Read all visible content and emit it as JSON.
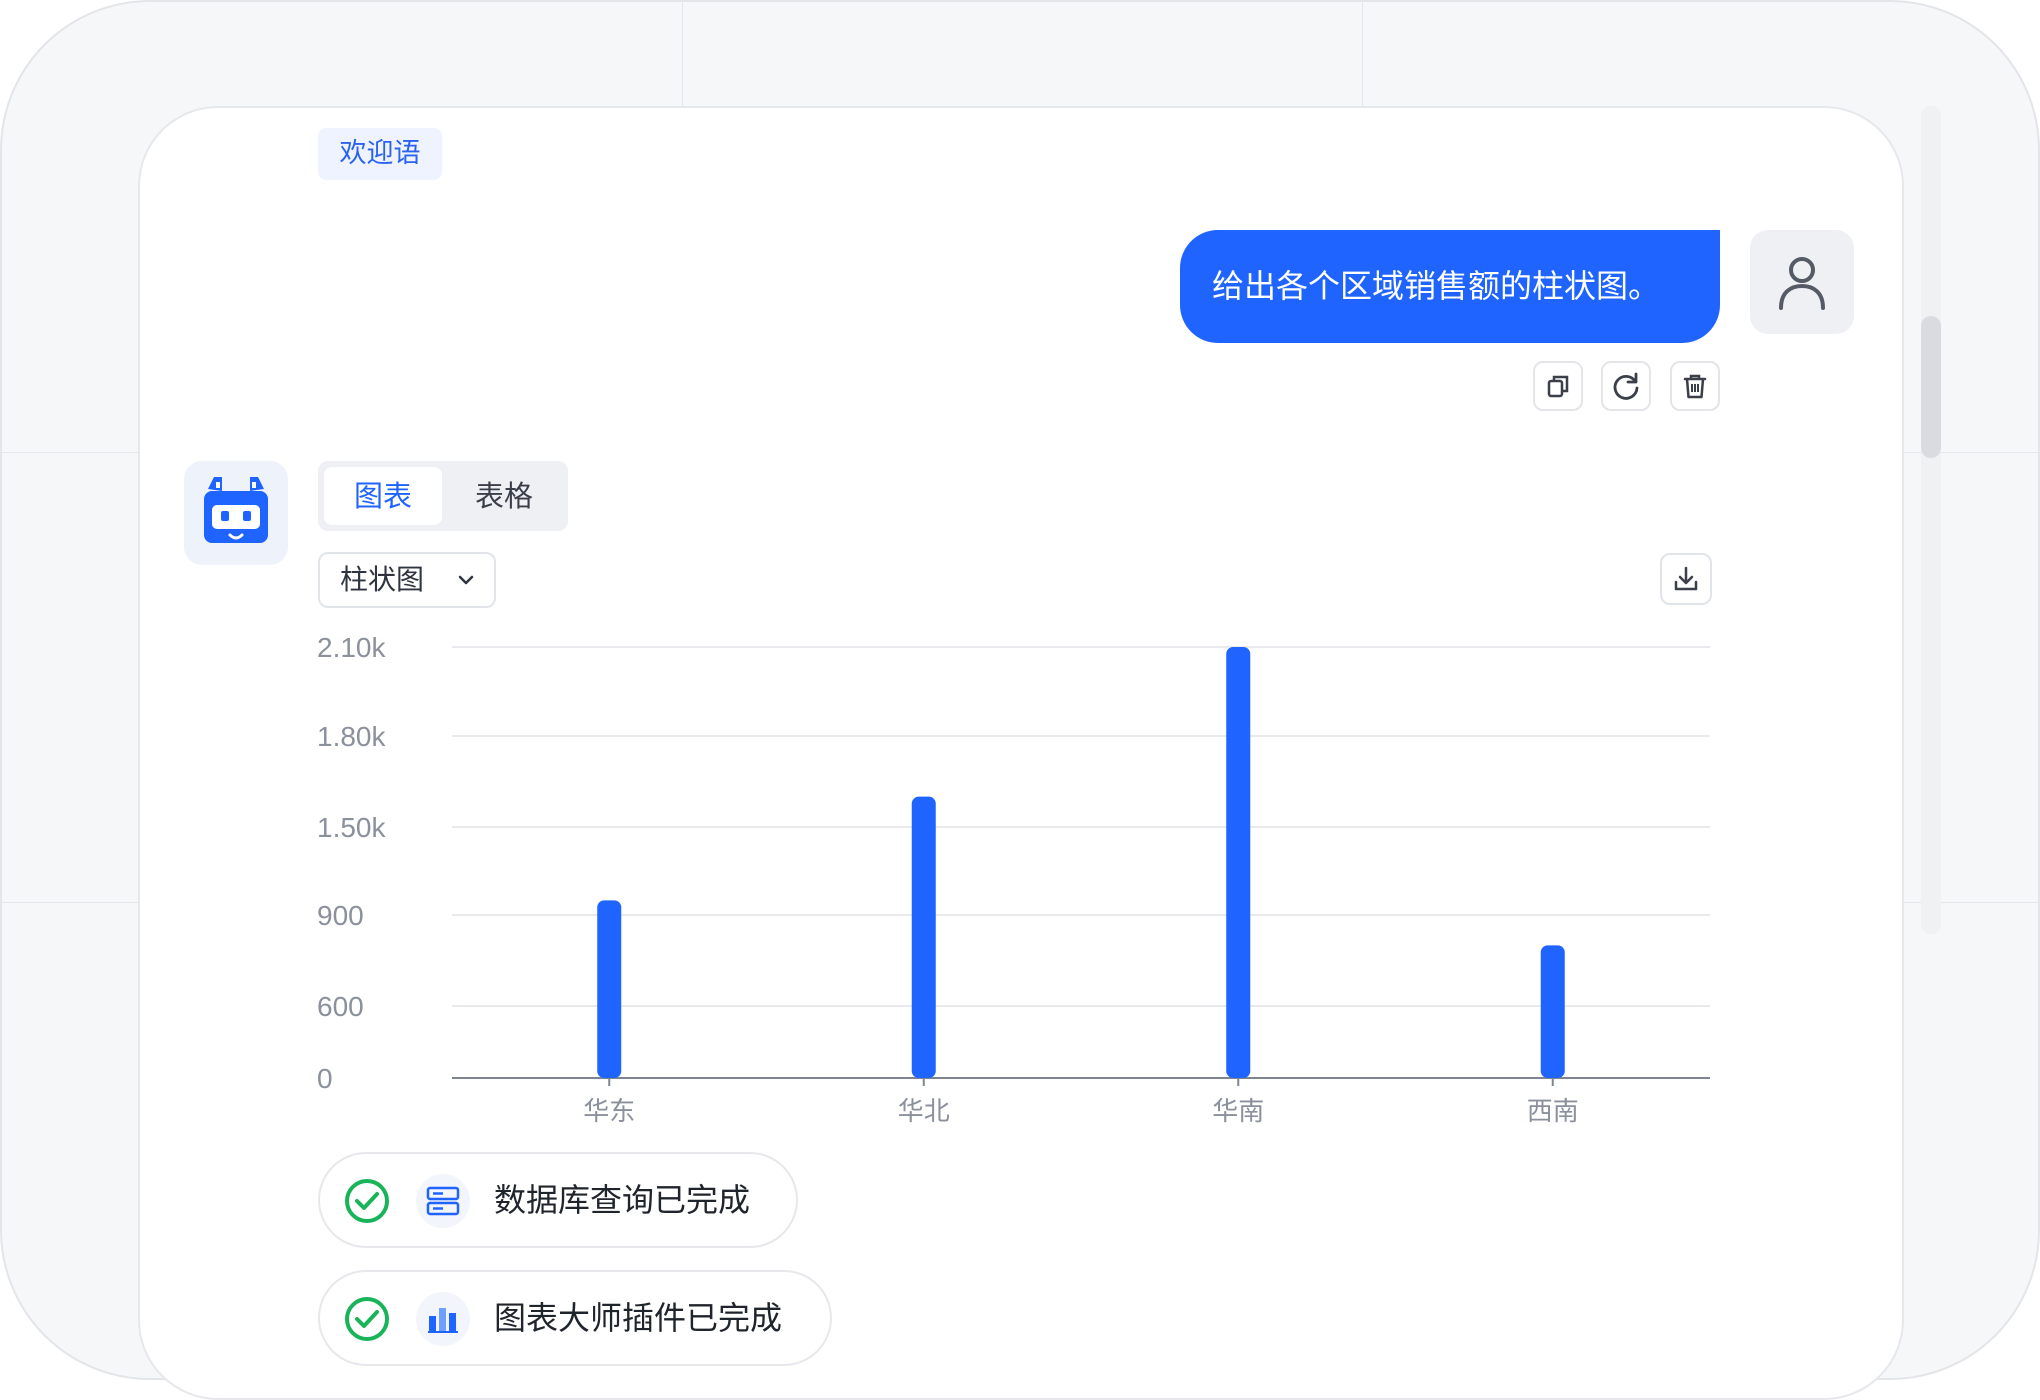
{
  "welcome_tag": "欢迎语",
  "user_message": "给出各个区域销售额的柱状图。",
  "message_actions": [
    "copy-icon",
    "refresh-icon",
    "trash-icon"
  ],
  "view_tabs": [
    {
      "label": "图表",
      "active": true
    },
    {
      "label": "表格",
      "active": false
    }
  ],
  "chart_type_select": {
    "value": "柱状图"
  },
  "chart_data": {
    "type": "bar",
    "categories": [
      "华东",
      "华北",
      "华南",
      "西南"
    ],
    "values": [
      1000,
      1600,
      2200,
      800
    ],
    "y_tick_labels": [
      "0",
      "600",
      "900",
      "1.50k",
      "1.80k",
      "2.10k"
    ],
    "bar_color": "#1f64ff"
  },
  "status_items": [
    {
      "label": "数据库查询已完成",
      "icon": "database-icon",
      "status": "done"
    },
    {
      "label": "图表大师插件已完成",
      "icon": "bar-chart-plugin-icon",
      "status": "done"
    }
  ],
  "colors": {
    "accent": "#1f64ff",
    "success": "#19b35a"
  }
}
